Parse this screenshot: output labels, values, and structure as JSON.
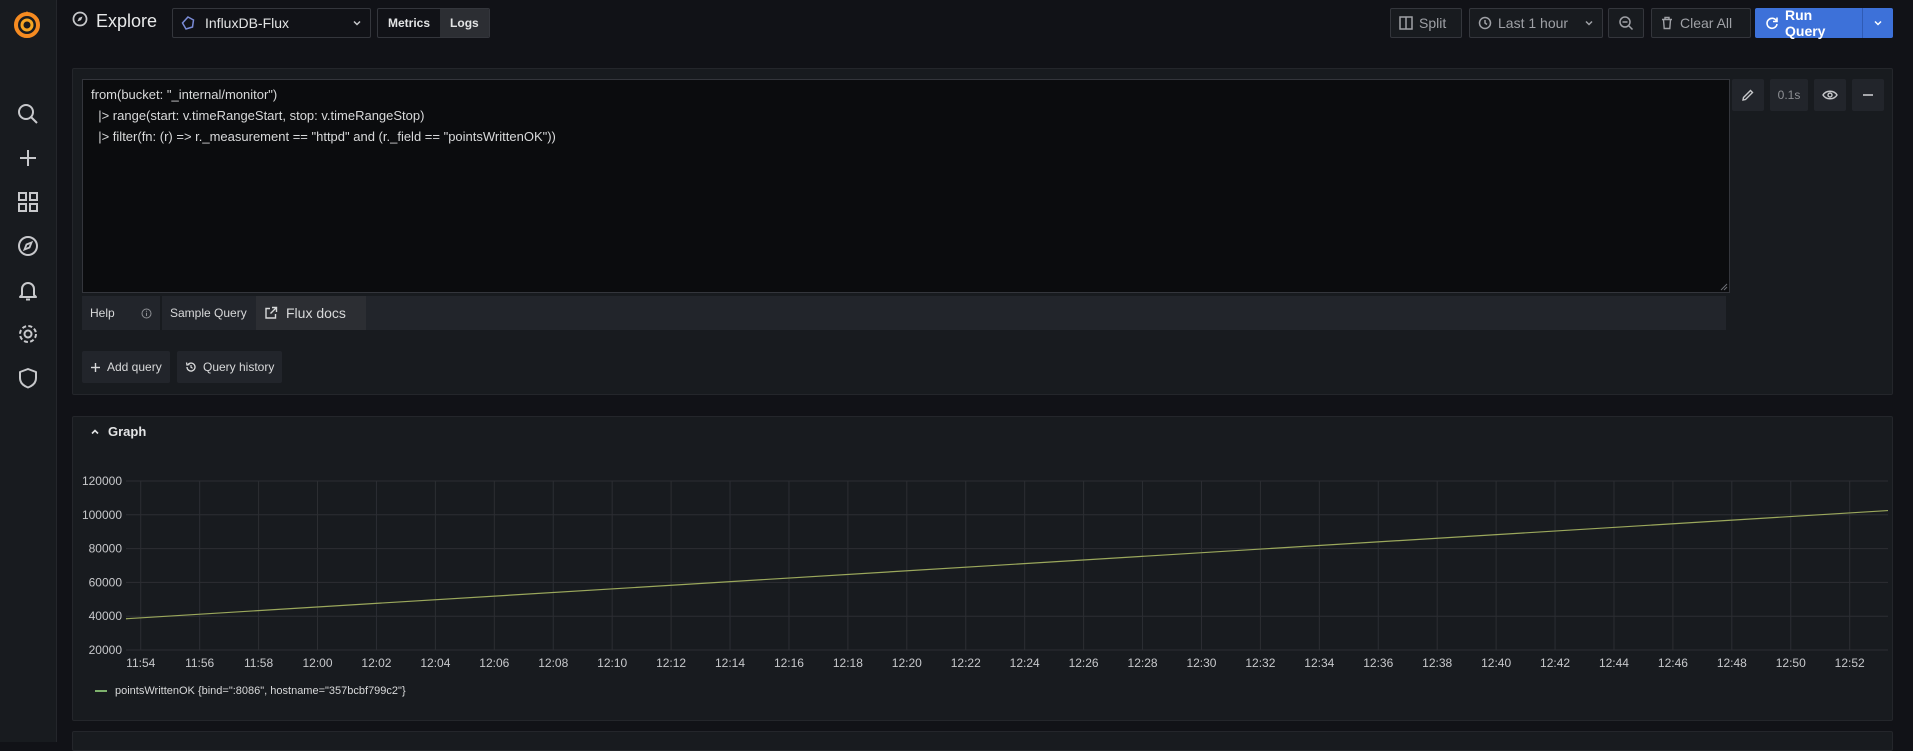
{
  "page": {
    "title": "Explore"
  },
  "datasource": {
    "name": "InfluxDB-Flux"
  },
  "mode_tabs": [
    {
      "label": "Metrics"
    },
    {
      "label": "Logs"
    }
  ],
  "toolbar": {
    "split_label": "Split",
    "time_range_label": "Last 1 hour",
    "clear_all_label": "Clear All",
    "run_query_label": "Run Query"
  },
  "query": {
    "lines": [
      "from(bucket: \"_internal/monitor\")",
      "  |> range(start: v.timeRangeStart, stop: v.timeRangeStop)",
      "  |> filter(fn: (r) => r._measurement == \"httpd\" and (r._field == \"pointsWrittenOK\"))"
    ],
    "exec_time": "0.1s"
  },
  "help_bar": {
    "help": "Help",
    "sample_query": "Sample Query",
    "flux_docs": "Flux docs"
  },
  "actions": {
    "add_query": "Add query",
    "query_history": "Query history"
  },
  "graph": {
    "title": "Graph"
  },
  "colors": {
    "accent": "#3d71d9",
    "series": "#9ba85c",
    "logo": "#f58b21"
  },
  "chart_data": {
    "type": "line",
    "x_labels": [
      "11:54",
      "11:56",
      "11:58",
      "12:00",
      "12:02",
      "12:04",
      "12:06",
      "12:08",
      "12:10",
      "12:12",
      "12:14",
      "12:16",
      "12:18",
      "12:20",
      "12:22",
      "12:24",
      "12:26",
      "12:28",
      "12:30",
      "12:32",
      "12:34",
      "12:36",
      "12:38",
      "12:40",
      "12:42",
      "12:44",
      "12:46",
      "12:48",
      "12:50",
      "12:52"
    ],
    "y_ticks": [
      20000,
      40000,
      60000,
      80000,
      100000,
      120000
    ],
    "ylim": [
      20000,
      120000
    ],
    "x_range_minutes": [
      -0.5,
      59.3
    ],
    "series": [
      {
        "name": "pointsWrittenOK {bind=\":8086\", hostname=\"357bcbf799c2\"}",
        "x": [
          -0.5,
          59.3
        ],
        "y": [
          38500,
          102500
        ]
      }
    ],
    "legend_position": "bottom-left",
    "grid": true
  }
}
